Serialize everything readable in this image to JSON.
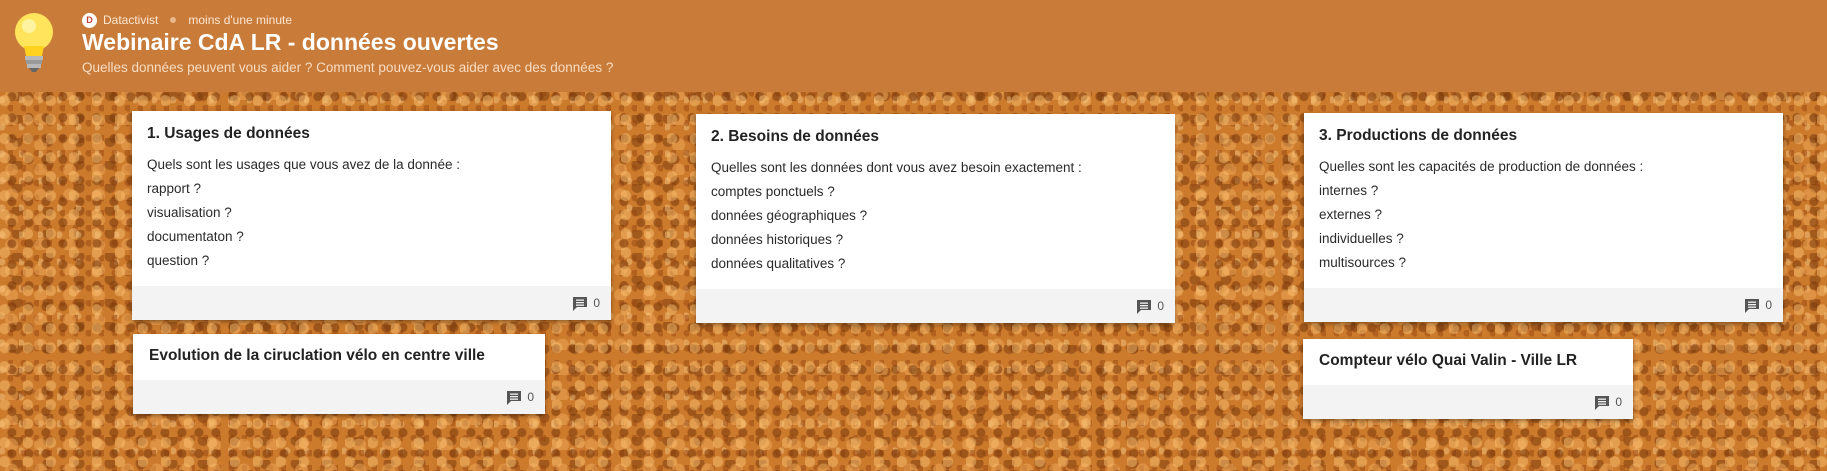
{
  "header": {
    "author": "Datactivist",
    "time": "moins d'une minute",
    "title": "Webinaire CdA LR - données ouvertes",
    "subtitle": "Quelles données peuvent vous aider ? Comment pouvez-vous aider avec des données ?",
    "avatar_icon": "datactivist-avatar-icon",
    "logo_icon": "lightbulb-icon"
  },
  "cards": [
    {
      "title": "1. Usages de données",
      "lines": [
        "Quels sont les usages que vous avez de la donnée :",
        "rapport ?",
        "visualisation ?",
        "documentaton ?",
        "question ?"
      ],
      "comments": "0"
    },
    {
      "title": "2. Besoins de données",
      "lines": [
        "Quelles sont les données dont vous avez besoin exactement :",
        "comptes ponctuels ?",
        "données géographiques ?",
        "données historiques ?",
        "données qualitatives ?"
      ],
      "comments": "0"
    },
    {
      "title": "3. Productions de données",
      "lines": [
        "Quelles sont les capacités de production de données :",
        "internes ?",
        "externes ?",
        "individuelles ?",
        "multisources ?"
      ],
      "comments": "0"
    },
    {
      "title": "Evolution de la ciruclation vélo en centre ville",
      "lines": [],
      "comments": "0"
    },
    {
      "title": "Compteur vélo Quai Valin - Ville LR",
      "lines": [],
      "comments": "0"
    }
  ],
  "colors": {
    "header": "#c97b3a",
    "background": "#cc7a2c",
    "card": "#ffffff",
    "card_footer": "#f3f3f3"
  }
}
